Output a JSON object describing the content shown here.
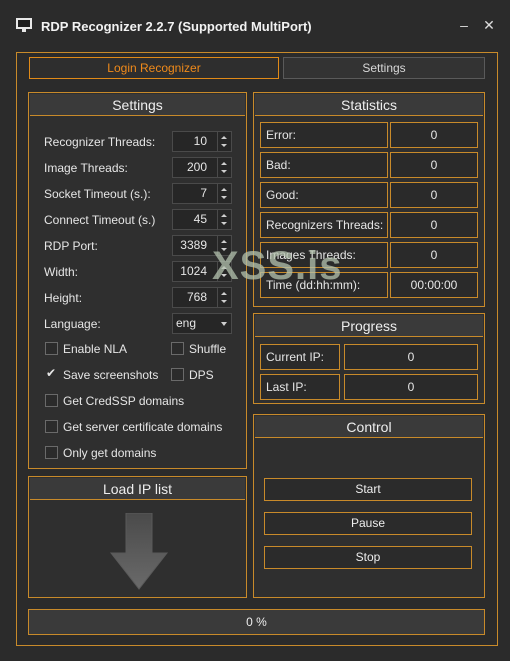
{
  "window": {
    "title": "RDP Recognizer 2.2.7 (Supported MultiPort)",
    "minimize_label": "–",
    "close_label": "✕"
  },
  "tabs": [
    {
      "label": "Login Recognizer",
      "active": true
    },
    {
      "label": "Settings",
      "active": false
    }
  ],
  "settings": {
    "header": "Settings",
    "fields": [
      {
        "label": "Recognizer Threads:",
        "value": "10"
      },
      {
        "label": "Image Threads:",
        "value": "200"
      },
      {
        "label": "Socket Timeout (s.):",
        "value": "7"
      },
      {
        "label": "Connect Timeout (s.)",
        "value": "45"
      },
      {
        "label": "RDP Port:",
        "value": "3389"
      },
      {
        "label": "Width:",
        "value": "1024"
      },
      {
        "label": "Height:",
        "value": "768"
      }
    ],
    "language": {
      "label": "Language:",
      "value": "eng"
    },
    "checkboxes": [
      {
        "label": "Enable NLA",
        "checked": false
      },
      {
        "label": "Shuffle",
        "checked": false
      },
      {
        "label": "Save screenshots",
        "checked": true
      },
      {
        "label": "DPS",
        "checked": false
      },
      {
        "label": "Get CredSSP domains",
        "checked": false
      },
      {
        "label": "Get server certificate domains",
        "checked": false
      },
      {
        "label": "Only get domains",
        "checked": false
      }
    ],
    "checkmark": "✔"
  },
  "load_ip": {
    "header": "Load IP list",
    "icon": "download-arrow-icon"
  },
  "statistics": {
    "header": "Statistics",
    "rows": [
      {
        "label": "Error:",
        "value": "0"
      },
      {
        "label": "Bad:",
        "value": "0"
      },
      {
        "label": "Good:",
        "value": "0"
      },
      {
        "label": "Recognizers Threads:",
        "value": "0"
      },
      {
        "label": "Images Threads:",
        "value": "0"
      },
      {
        "label": "Time (dd:hh:mm):",
        "value": "00:00:00"
      }
    ]
  },
  "progress": {
    "header": "Progress",
    "rows": [
      {
        "label": "Current IP:",
        "value": "0"
      },
      {
        "label": "Last IP:",
        "value": "0"
      }
    ]
  },
  "control": {
    "header": "Control",
    "buttons": [
      "Start",
      "Pause",
      "Stop"
    ]
  },
  "progress_bar": {
    "text": "0 %",
    "fraction": 0
  },
  "watermark": "XSS.is",
  "colors": {
    "accent": "#e08a18",
    "border": "#c88a2a",
    "background": "#2b2b2b"
  }
}
